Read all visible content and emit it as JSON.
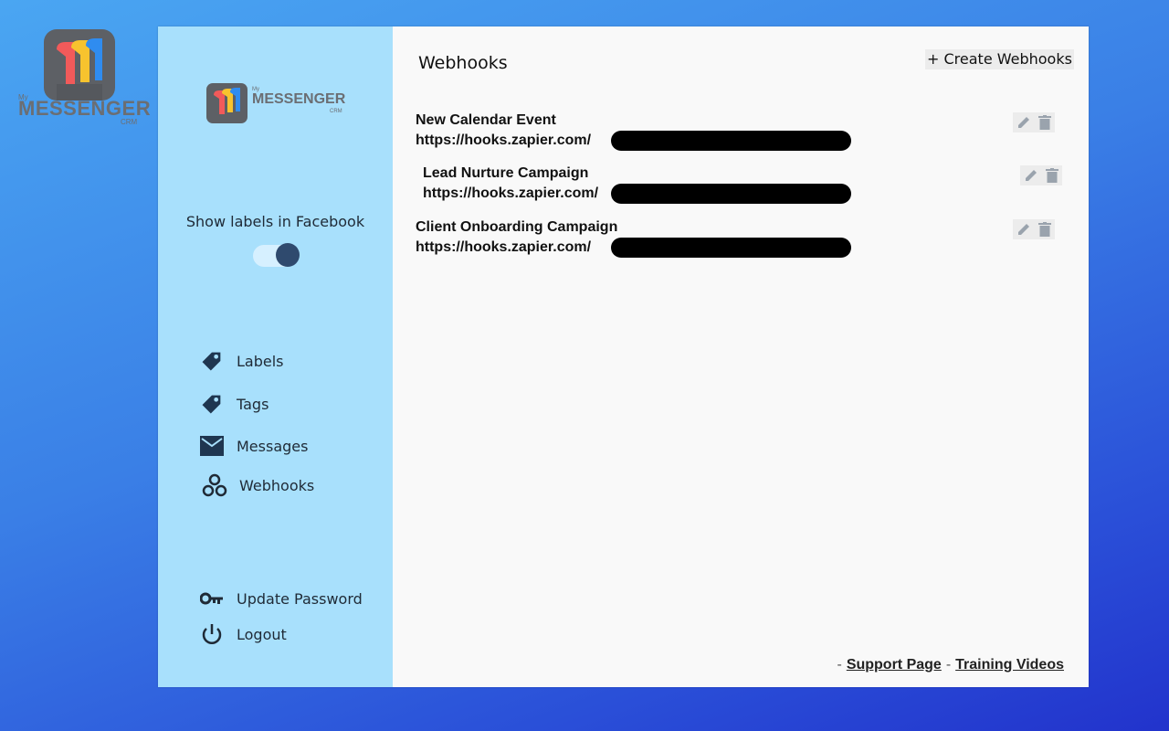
{
  "brand": {
    "small": "My",
    "name": "MESSENGER",
    "suffix": "CRM"
  },
  "sidebar": {
    "toggle_label": "Show labels in Facebook",
    "toggle_on": true,
    "nav": [
      {
        "label": "Labels",
        "icon": "tag-icon"
      },
      {
        "label": "Tags",
        "icon": "tag-icon"
      },
      {
        "label": "Messages",
        "icon": "envelope-icon"
      },
      {
        "label": "Webhooks",
        "icon": "webhook-icon"
      }
    ],
    "bottom": [
      {
        "label": "Update Password",
        "icon": "key-icon"
      },
      {
        "label": "Logout",
        "icon": "power-icon"
      }
    ]
  },
  "main": {
    "title": "Webhooks",
    "create_label": "+ Create Webhooks",
    "webhooks": [
      {
        "name": "New Calendar Event",
        "url": "https://hooks.zapier.com/"
      },
      {
        "name": "Lead Nurture Campaign",
        "url": "https://hooks.zapier.com/"
      },
      {
        "name": "Client Onboarding Campaign",
        "url": "https://hooks.zapier.com/"
      }
    ]
  },
  "footer": {
    "dash1": "-",
    "support": "Support Page",
    "dash2": "-",
    "training": "Training Videos"
  },
  "colors": {
    "sidebar_bg": "#a8e0fc",
    "toggle_knob": "#2f4a6e",
    "logo_red": "#f25a5a",
    "logo_yellow": "#f7c32e",
    "logo_blue": "#2f8cf0"
  }
}
